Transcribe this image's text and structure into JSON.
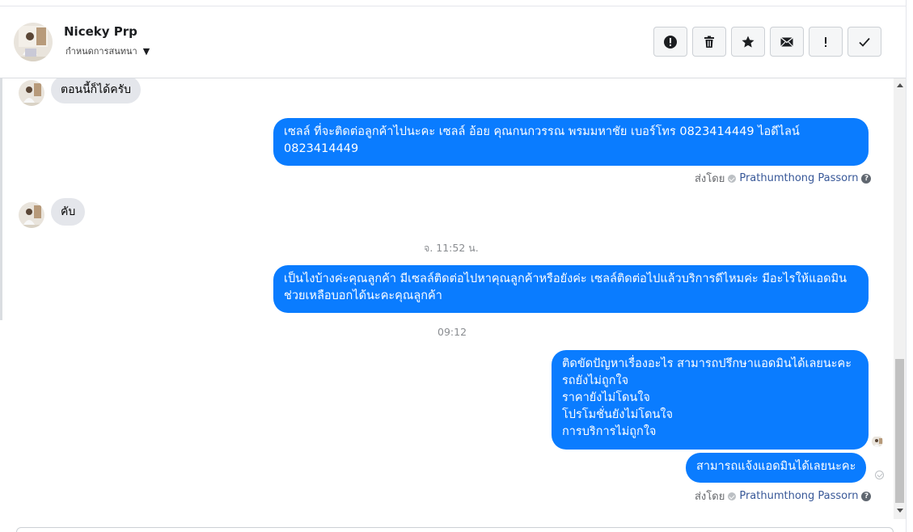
{
  "header": {
    "contact_name": "Niceky Prp",
    "subtitle": "กำหนดการสนทนา",
    "actions": [
      {
        "icon": "exclamation-circle-icon",
        "label": "spam"
      },
      {
        "icon": "trash-icon",
        "label": "delete"
      },
      {
        "icon": "star-icon",
        "label": "star"
      },
      {
        "icon": "envelope-icon",
        "label": "mark unread"
      },
      {
        "icon": "exclamation-icon",
        "label": "follow up"
      },
      {
        "icon": "check-icon",
        "label": "done"
      }
    ]
  },
  "messages": {
    "m1": "ตอนนี้ก็ได้ครับ",
    "m2": "เซลล์ ที่จะติดต่อลูกค้าไปนะคะ เซลล์ อ้อย คุณกนกวรรณ พรมมหาชัย เบอร์โทร 0823414449 ไอดีไลน์ 0823414449",
    "m2_sent_by_label": "ส่งโดย",
    "m2_sent_by_name": "Prathumthong Passorn",
    "m3": "คับ",
    "ts1": "จ. 11:52 น.",
    "m4": "เป็นไงบ้างค่ะคุณลูกค้า มีเซลล์ติดต่อไปหาคุณลูกค้าหรือยังค่ะ  เซลล์ติดต่อไปแล้วบริการดีไหมค่ะ มีอะไรให้แอดมินช่วยเหลือบอกได้นะคะคุณลูกค้า",
    "ts2": "09:12",
    "m5_lines": [
      "ติดขัดปัญหาเรื่องอะไร สามารถปรึกษาแอดมินได้เลยนะคะ",
      "รถยังไม่ถูกใจ",
      "ราคายังไม่โดนใจ",
      "โปรโมชั่นยังไม่โดนใจ",
      "การบริการไม่ถูกใจ"
    ],
    "m6": "สามารถแจ้งแอดมินได้เลยนะคะ",
    "m6_sent_by_label": "ส่งโดย",
    "m6_sent_by_name": "Prathumthong Passorn",
    "help_glyph": "?"
  },
  "colors": {
    "outgoing_bubble": "#0a7cff",
    "incoming_bubble": "#e4e6eb"
  }
}
